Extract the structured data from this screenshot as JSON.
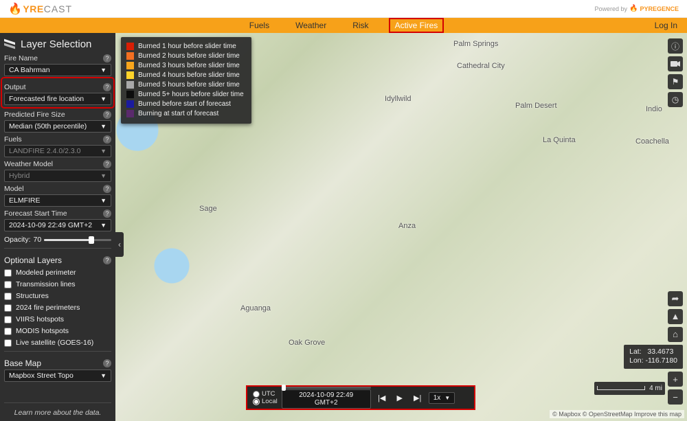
{
  "branding": {
    "f": "F",
    "yre": "YRE",
    "cast": "CAST",
    "powered_prefix": "Powered by",
    "powered_brand": "PYREGENCE"
  },
  "nav": {
    "items": [
      "Fuels",
      "Weather",
      "Risk",
      "Active Fires"
    ],
    "active_index": 3,
    "login": "Log In"
  },
  "sidebar": {
    "title": "Layer Selection",
    "fields": {
      "fire_name": {
        "label": "Fire Name",
        "value": "CA Bahrman"
      },
      "output": {
        "label": "Output",
        "value": "Forecasted fire location"
      },
      "fire_size": {
        "label": "Predicted Fire Size",
        "value": "Median (50th percentile)"
      },
      "fuels": {
        "label": "Fuels",
        "value": "LANDFIRE 2.4.0/2.3.0",
        "disabled": true
      },
      "wx_model": {
        "label": "Weather Model",
        "value": "Hybrid",
        "disabled": true
      },
      "model": {
        "label": "Model",
        "value": "ELMFIRE"
      },
      "start_time": {
        "label": "Forecast Start Time",
        "value": "2024-10-09 22:49 GMT+2"
      }
    },
    "opacity": {
      "label": "Opacity:",
      "value": "70"
    },
    "optional": {
      "title": "Optional Layers",
      "items": [
        "Modeled perimeter",
        "Transmission lines",
        "Structures",
        "2024 fire perimeters",
        "VIIRS hotspots",
        "MODIS hotspots",
        "Live satellite (GOES-16)"
      ]
    },
    "basemap": {
      "title": "Base Map",
      "value": "Mapbox Street Topo"
    },
    "learn": "Learn more about the data."
  },
  "legend": {
    "items": [
      {
        "color": "#d81e05",
        "label": "Burned 1 hour before slider time"
      },
      {
        "color": "#f36f21",
        "label": "Burned 2 hours before slider time"
      },
      {
        "color": "#f8a61c",
        "label": "Burned 3 hours before slider time"
      },
      {
        "color": "#fdd32a",
        "label": "Burned 4 hours before slider time"
      },
      {
        "color": "#a9a9a9",
        "label": "Burned 5 hours before slider time"
      },
      {
        "color": "#0d0d0d",
        "label": "Burned 5+ hours before slider time"
      },
      {
        "color": "#1b1b9e",
        "label": "Burned before start of forecast"
      },
      {
        "color": "#5a2a6c",
        "label": "Burning at start of forecast"
      }
    ]
  },
  "right_tools": [
    "info-icon",
    "camera-icon",
    "flag-icon",
    "clock-icon"
  ],
  "br_tools": [
    "share-icon",
    "terrain-icon",
    "home-icon",
    "plus-icon",
    "minus-icon"
  ],
  "coords": {
    "lat_label": "Lat:",
    "lat": "33.4673",
    "lon_label": "Lon:",
    "lon": "-116.7180"
  },
  "scale": {
    "value": "4 mi"
  },
  "time": {
    "tz": {
      "utc": "UTC",
      "local": "Local"
    },
    "value": "2024-10-09 22:49 GMT+2",
    "speed": "1x"
  },
  "map_labels": {
    "palm_springs": "Palm Springs",
    "cathedral_city": "Cathedral City",
    "palm_desert": "Palm Desert",
    "la_quinta": "La Quinta",
    "indio": "Indio",
    "coachella": "Coachella",
    "idyllwild": "Idyllwild",
    "anza": "Anza",
    "sage": "Sage",
    "aguanga": "Aguanga",
    "oak_grove": "Oak Grove"
  },
  "attrib": "© Mapbox © OpenStreetMap Improve this map"
}
